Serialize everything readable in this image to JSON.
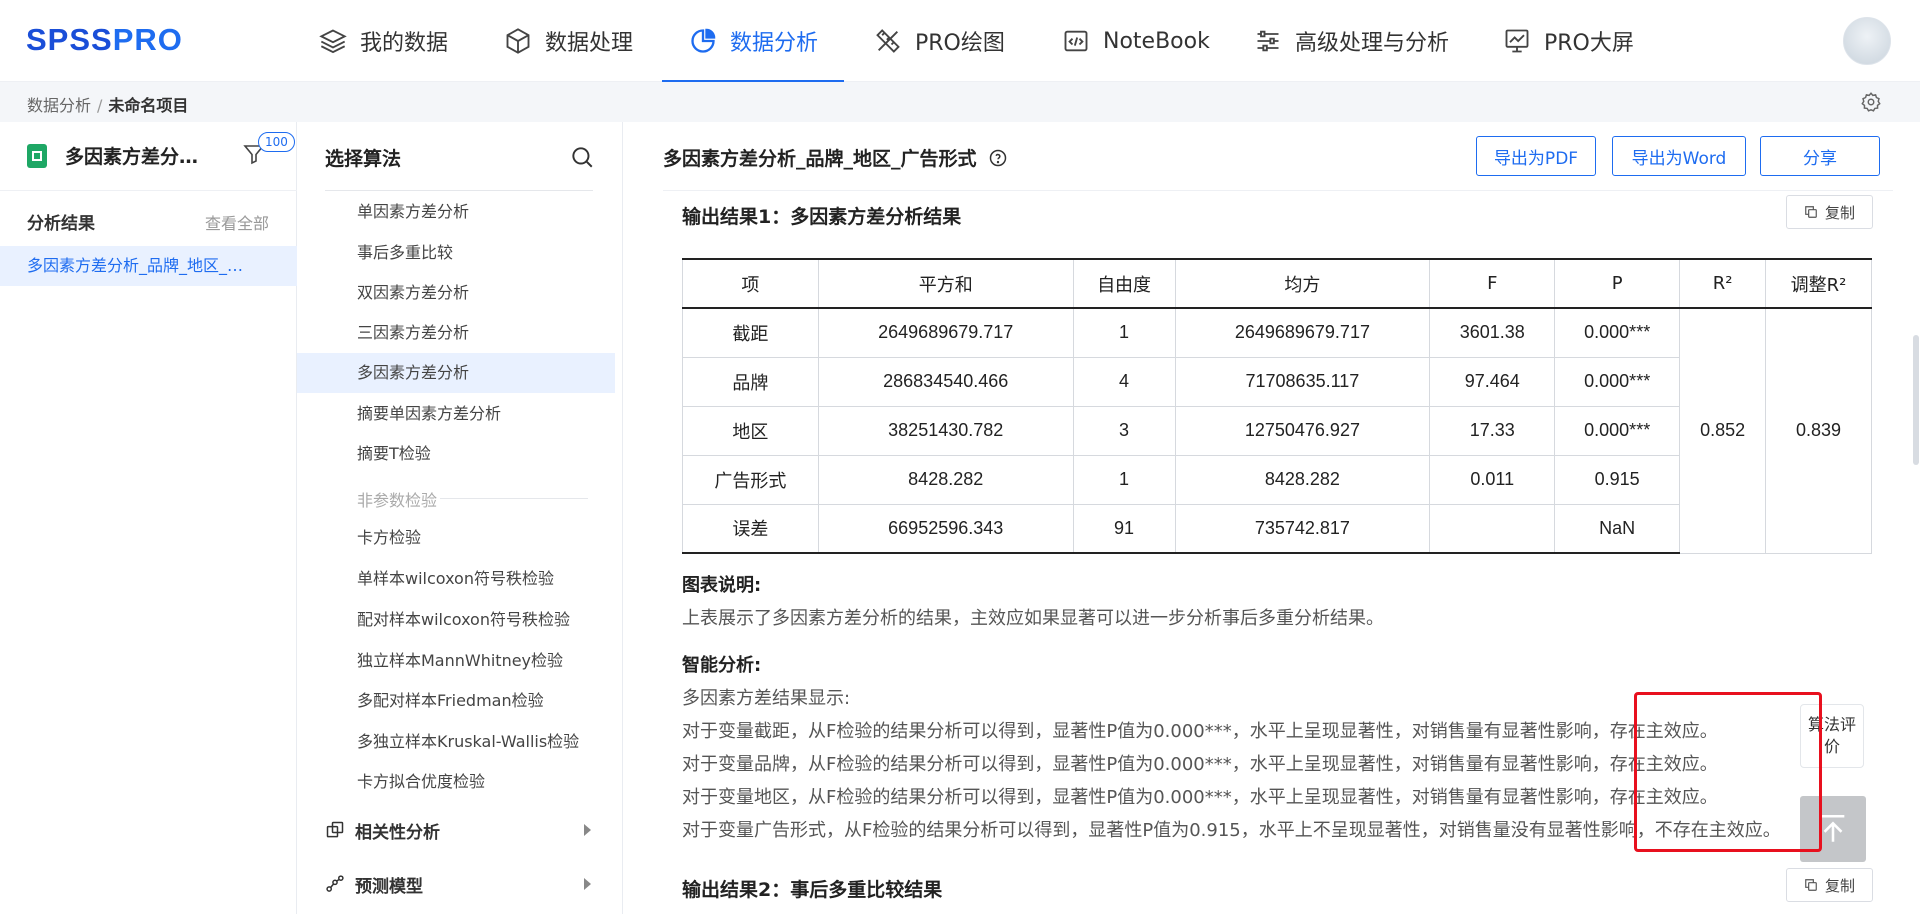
{
  "brand": {
    "spss": "SPSS",
    "pro": "PRO"
  },
  "nav": [
    {
      "label": "我的数据",
      "icon": "layers-icon"
    },
    {
      "label": "数据处理",
      "icon": "cube-icon"
    },
    {
      "label": "数据分析",
      "icon": "pie-chart-icon",
      "active": true
    },
    {
      "label": "PRO绘图",
      "icon": "ruler-pen-icon"
    },
    {
      "label": "NoteBook",
      "icon": "code-window-icon"
    },
    {
      "label": "高级处理与分析",
      "icon": "sliders-icon"
    },
    {
      "label": "PRO大屏",
      "icon": "monitor-chart-icon"
    }
  ],
  "breadcrumb": {
    "root": "数据分析",
    "sep": "/",
    "current": "未命名项目"
  },
  "left": {
    "project_name": "多因素方差分…",
    "badge": "100",
    "results_title": "分析结果",
    "view_all": "查看全部",
    "result_item": "多因素方差分析_品牌_地区_…"
  },
  "algorithms": {
    "title": "选择算法",
    "items": [
      "单因素方差分析",
      "事后多重比较",
      "双因素方差分析",
      "三因素方差分析",
      "多因素方差分析",
      "摘要单因素方差分析",
      "摘要T检验"
    ],
    "group_label": "非参数检验",
    "nonparam": [
      "卡方检验",
      "单样本wilcoxon符号秩检验",
      "配对样本wilcoxon符号秩检验",
      "独立样本MannWhitney检验",
      "多配对样本Friedman检验",
      "多独立样本Kruskal-Wallis检验",
      "卡方拟合优度检验"
    ],
    "categories": [
      "相关性分析",
      "预测模型"
    ]
  },
  "main": {
    "title": "多因素方差分析_品牌_地区_广告形式",
    "export_pdf": "导出为PDF",
    "export_word": "导出为Word",
    "share": "分享",
    "section1": "输出结果1：多因素方差分析结果",
    "copy": "复制",
    "table": {
      "headers": [
        "项",
        "平方和",
        "自由度",
        "均方",
        "F",
        "P",
        "R²",
        "调整R²"
      ],
      "rows": [
        [
          "截距",
          "2649689679.717",
          "1",
          "2649689679.717",
          "3601.38",
          "0.000***"
        ],
        [
          "品牌",
          "286834540.466",
          "4",
          "71708635.117",
          "97.464",
          "0.000***"
        ],
        [
          "地区",
          "38251430.782",
          "3",
          "12750476.927",
          "17.33",
          "0.000***"
        ],
        [
          "广告形式",
          "8428.282",
          "1",
          "8428.282",
          "0.011",
          "0.915"
        ],
        [
          "误差",
          "66952596.343",
          "91",
          "735742.817",
          "",
          "NaN"
        ]
      ],
      "r2": "0.852",
      "adj_r2": "0.839"
    },
    "chart_note_label": "图表说明:",
    "chart_note": "上表展示了多因素方差分析的结果，主效应如果显著可以进一步分析事后多重分析结果。",
    "smart_label": "智能分析:",
    "smart_lines": [
      "多因素方差结果显示:",
      "对于变量截距，从F检验的结果分析可以得到，显著性P值为0.000***，水平上呈现显著性，对销售量有显著性影响，存在主效应。",
      "对于变量品牌，从F检验的结果分析可以得到，显著性P值为0.000***，水平上呈现显著性，对销售量有显著性影响，存在主效应。",
      "对于变量地区，从F检验的结果分析可以得到，显著性P值为0.000***，水平上呈现显著性，对销售量有显著性影响，存在主效应。",
      "对于变量广告形式，从F检验的结果分析可以得到，显著性P值为0.915，水平上不呈现显著性，对销售量没有显著性影响，不存在主效应。"
    ],
    "section2": "输出结果2：事后多重比较结果",
    "eval_label": "算法评价"
  }
}
